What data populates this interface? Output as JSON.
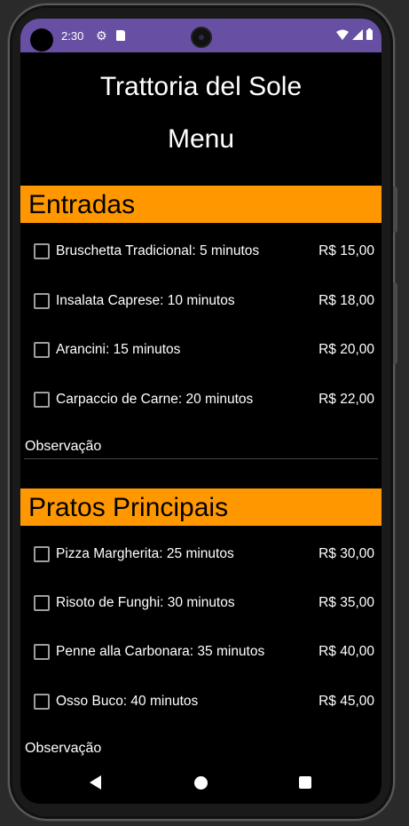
{
  "status_bar": {
    "time": "2:30",
    "icons": [
      "gear-icon",
      "sd-card-icon",
      "wifi-icon",
      "signal-icon",
      "battery-icon"
    ],
    "color": "#6750a4"
  },
  "header": {
    "restaurant": "Trattoria del Sole",
    "subtitle": "Menu"
  },
  "accent_color": "#ff9800",
  "sections": [
    {
      "title": "Entradas",
      "items": [
        {
          "label": "Bruschetta Tradicional: 5 minutos",
          "price": "R$ 15,00",
          "checked": false
        },
        {
          "label": "Insalata Caprese: 10 minutos",
          "price": "R$ 18,00",
          "checked": false
        },
        {
          "label": "Arancini: 15 minutos",
          "price": "R$ 20,00",
          "checked": false
        },
        {
          "label": "Carpaccio de Carne: 20 minutos",
          "price": "R$ 22,00",
          "checked": false
        }
      ],
      "observation_placeholder": "Observação"
    },
    {
      "title": "Pratos Principais",
      "items": [
        {
          "label": "Pizza Margherita: 25 minutos",
          "price": "R$ 30,00",
          "checked": false
        },
        {
          "label": "Risoto de Funghi: 30 minutos",
          "price": "R$ 35,00",
          "checked": false
        },
        {
          "label": "Penne alla Carbonara: 35 minutos",
          "price": "R$ 40,00",
          "checked": false
        },
        {
          "label": "Osso Buco: 40 minutos",
          "price": "R$ 45,00",
          "checked": false
        }
      ],
      "observation_placeholder": "Observação"
    }
  ],
  "nav": {
    "icons": [
      "back-icon",
      "home-icon",
      "recents-icon"
    ]
  }
}
